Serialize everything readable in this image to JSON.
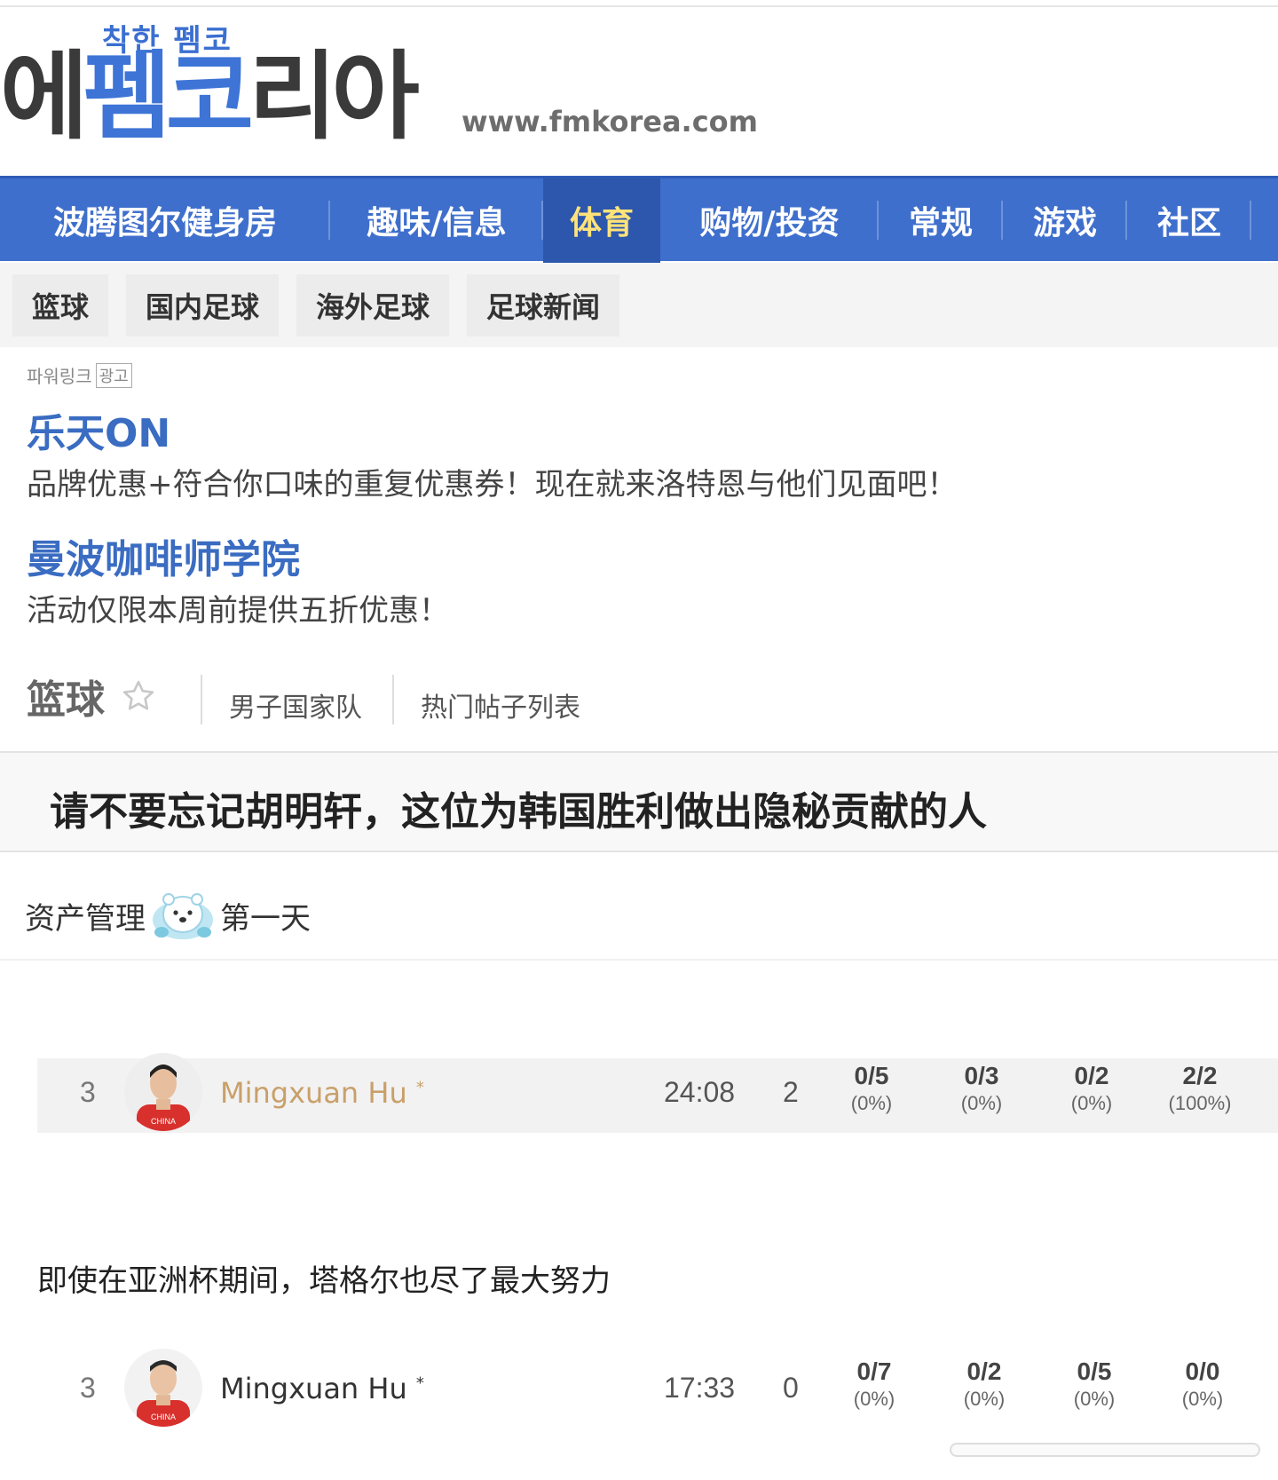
{
  "logo": {
    "subtitle": "착한 펨코",
    "main_dark_1": "에",
    "main_blue": "펨코",
    "main_dark_2": "리아",
    "url": "www.fmkorea.com"
  },
  "main_nav": [
    "波腾图尔健身房",
    "趣味/信息",
    "体育",
    "购物/投资",
    "常规",
    "游戏",
    "社区"
  ],
  "sub_nav": [
    "篮球",
    "国内足球",
    "海外足球",
    "足球新闻"
  ],
  "ads": {
    "tag": "파워링크",
    "tag_box": "광고",
    "items": [
      {
        "title": "乐天ON",
        "desc": "品牌优惠+符合你口味的重复优惠券！现在就来洛特恩与他们见面吧！"
      },
      {
        "title": "曼波咖啡师学院",
        "desc": "活动仅限本周前提供五折优惠！"
      }
    ]
  },
  "board": {
    "title": "篮球",
    "links": [
      "男子国家队",
      "热门帖子列表"
    ]
  },
  "post": {
    "title": "请不要忘记胡明轩，这位为韩国胜利做出隐秘贡献的人",
    "meta_before": "资产管理",
    "meta_after": "第一天",
    "note": "即使在亚洲杯期间，塔格尔也尽了最大努力"
  },
  "stat_rows": [
    {
      "num": "3",
      "name": "Mingxuan Hu",
      "mark": "*",
      "time": "24:08",
      "pts": "2",
      "stats": [
        {
          "f": "0/5",
          "p": "(0%)"
        },
        {
          "f": "0/3",
          "p": "(0%)"
        },
        {
          "f": "0/2",
          "p": "(0%)"
        },
        {
          "f": "2/2",
          "p": "(100%)"
        }
      ]
    },
    {
      "num": "3",
      "name": "Mingxuan Hu",
      "mark": "*",
      "time": "17:33",
      "pts": "0",
      "stats": [
        {
          "f": "0/7",
          "p": "(0%)"
        },
        {
          "f": "0/2",
          "p": "(0%)"
        },
        {
          "f": "0/5",
          "p": "(0%)"
        },
        {
          "f": "0/0",
          "p": "(0%)"
        }
      ]
    }
  ],
  "colors": {
    "nav_bg": "#3f6fcc",
    "nav_active_text": "#ffe37a",
    "ad_title": "#3a6cc2",
    "name_highlight": "#c9a06a"
  },
  "icons": {
    "star": "star-outline-icon",
    "bear": "polar-bear-emoji-icon"
  }
}
